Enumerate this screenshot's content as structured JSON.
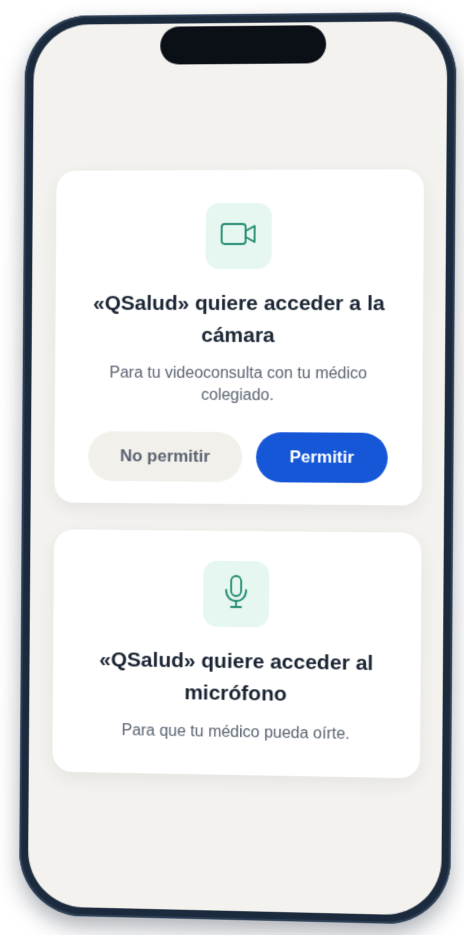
{
  "camera_prompt": {
    "icon": "video-camera-icon",
    "title": "«QSalud» quiere acceder a la cámara",
    "description": "Para tu videoconsulta con tu médico colegiado.",
    "deny_label": "No permitir",
    "allow_label": "Permitir"
  },
  "microphone_prompt": {
    "icon": "microphone-icon",
    "title": "«QSalud» quiere acceder al micrófono",
    "description": "Para que tu médico pueda oírte."
  },
  "colors": {
    "accent": "#1657d8",
    "icon_tint": "#1f8a6e",
    "icon_background": "#e6f6f1",
    "screen_background": "#f4f2ee",
    "phone_frame": "#1b2a3d"
  }
}
